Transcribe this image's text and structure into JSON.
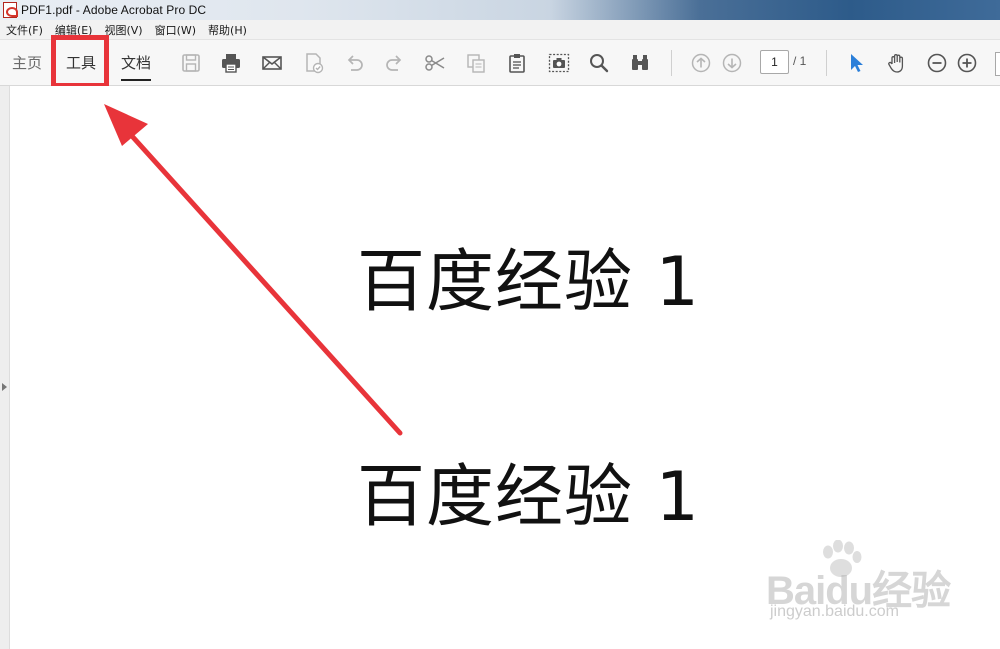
{
  "window": {
    "title": "PDF1.pdf - Adobe Acrobat Pro DC"
  },
  "menu": [
    {
      "label": "文件(F)"
    },
    {
      "label": "编辑(E)"
    },
    {
      "label": "视图(V)"
    },
    {
      "label": "窗口(W)"
    },
    {
      "label": "帮助(H)"
    }
  ],
  "tabs": {
    "home": "主页",
    "tools": "工具",
    "document": "文档"
  },
  "toolbar": {
    "icons": [
      "save-icon",
      "print-icon",
      "email-icon",
      "sign-document-icon",
      "undo-icon",
      "redo-icon",
      "cut-icon",
      "copy-icon",
      "paste-icon",
      "snapshot-icon",
      "search-icon",
      "compare-icon",
      "page-up-icon",
      "page-down-icon",
      "select-arrow-icon",
      "hand-icon",
      "zoom-out-icon",
      "zoom-in-icon"
    ],
    "current_page": "1",
    "total_pages": "/ 1"
  },
  "document": {
    "lines": [
      "百度经验 1",
      "百度经验 1"
    ]
  },
  "annotation": {
    "highlight_color": "#e8343a"
  },
  "watermark": {
    "brand": "Baidu经验",
    "url": "jingyan.baidu.com"
  }
}
